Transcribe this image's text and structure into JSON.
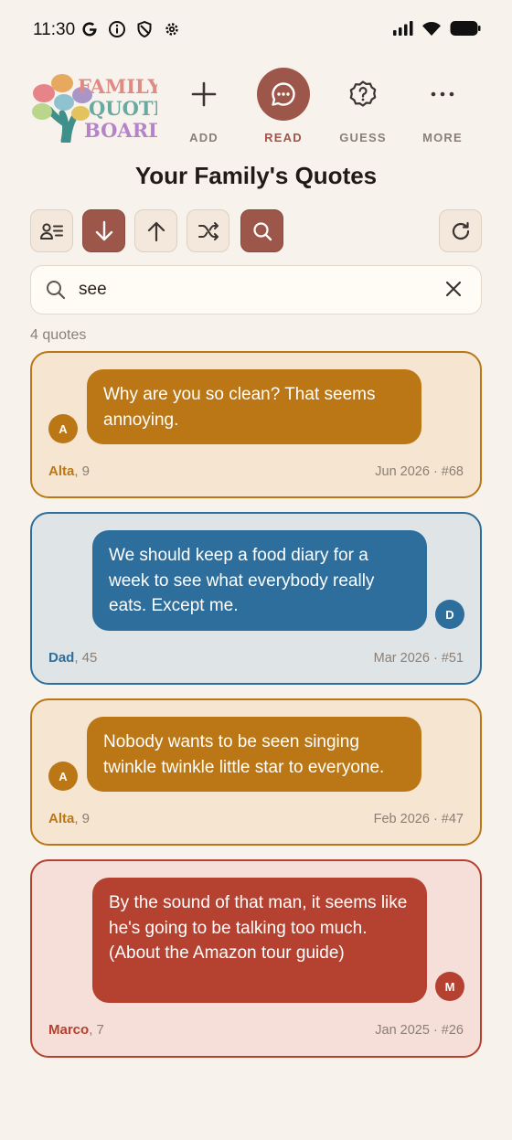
{
  "status": {
    "time": "11:30"
  },
  "header": {
    "logo": {
      "line1": "FAMILY",
      "line2": "QUOTE",
      "line3": "BOARD"
    },
    "nav": [
      {
        "label": "ADD",
        "icon": "plus-icon"
      },
      {
        "label": "READ",
        "icon": "chat-bubble-icon",
        "active": true
      },
      {
        "label": "GUESS",
        "icon": "question-badge-icon"
      },
      {
        "label": "MORE",
        "icon": "more-dots-icon"
      }
    ]
  },
  "page_title": "Your Family's Quotes",
  "toolbar": {
    "buttons": [
      {
        "icon": "filter-person-icon",
        "active": false
      },
      {
        "icon": "sort-down-icon",
        "active": true
      },
      {
        "icon": "sort-up-icon",
        "active": false
      },
      {
        "icon": "shuffle-icon",
        "active": false
      },
      {
        "icon": "search-icon",
        "active": true
      },
      {
        "icon": "refresh-icon",
        "active": false
      }
    ]
  },
  "search": {
    "value": "see"
  },
  "result_count": "4 quotes",
  "quotes": [
    {
      "text": "Why are you so clean? That seems annoying.",
      "initial": "A",
      "name": "Alta",
      "age": ", 9",
      "meta": "Jun 2026 · #68"
    },
    {
      "text": "We should keep a food diary for a week to see what everybody really eats. Except me.",
      "initial": "D",
      "name": "Dad",
      "age": ", 45",
      "meta": "Mar 2026 · #51"
    },
    {
      "text": "Nobody wants to be seen singing twinkle twinkle little star to everyone.",
      "initial": "A",
      "name": "Alta",
      "age": ", 9",
      "meta": "Feb 2026 · #47"
    },
    {
      "text": "By the sound of that man, it seems like he's going to be talking too much. (About the Amazon tour guide)",
      "initial": "M",
      "name": "Marco",
      "age": ", 7",
      "meta": "Jan 2025 · #26"
    }
  ],
  "colors": {
    "accent": "#9c564a",
    "alta": "#bb7715",
    "dad": "#2e6e9d",
    "marco": "#b54130",
    "background": "#f7f3ec"
  }
}
